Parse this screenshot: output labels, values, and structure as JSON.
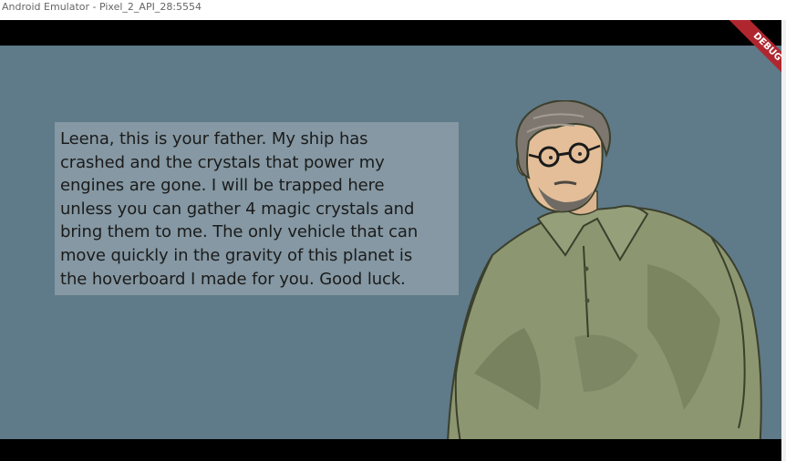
{
  "window": {
    "title": "Android Emulator - Pixel_2_API_28:5554"
  },
  "debug_banner": {
    "label": "DEBUG"
  },
  "dialog": {
    "line1": "Leena, this is your father. My ship has",
    "line2": "crashed and the crystals  that power my",
    "line3": "engines are gone. I will be trapped here",
    "line4": "unless you can gather 4 magic crystals and",
    "line5": "bring them to me. The only vehicle that can",
    "line6": "move quickly in the gravity of this planet is",
    "line7": "the hoverboard I made for you. Good luck."
  },
  "character": {
    "icon": "father-character-portrait"
  },
  "colors": {
    "game_background": "#5f7a89",
    "dialog_background": "#8598a3",
    "debug_ribbon": "#b0262f",
    "shirt": "#8c9670"
  }
}
